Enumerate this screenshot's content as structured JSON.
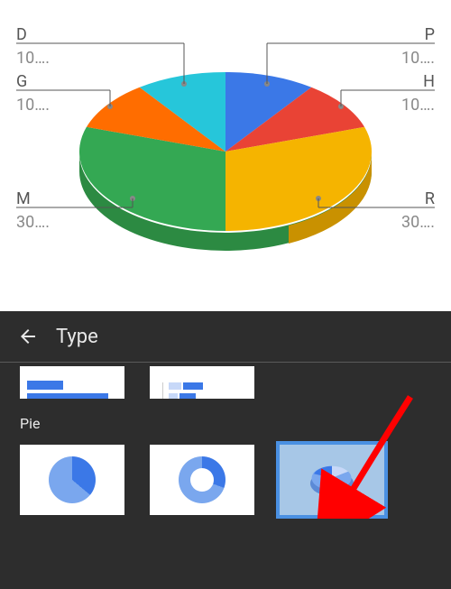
{
  "chart_data": {
    "type": "pie",
    "style": "3d",
    "slices": [
      {
        "label": "P",
        "value": 10,
        "color": "#3b78e7"
      },
      {
        "label": "H",
        "value": 10,
        "color": "#e94335"
      },
      {
        "label": "R",
        "value": 30,
        "color": "#f5b400"
      },
      {
        "label": "M",
        "value": 30,
        "color": "#34a853"
      },
      {
        "label": "G",
        "value": 10,
        "color": "#ff6d00"
      },
      {
        "label": "D",
        "value": 10,
        "color": "#26c6da"
      }
    ],
    "value_display_suffix": "…."
  },
  "labels": {
    "D": {
      "name": "D",
      "val": "10…."
    },
    "G": {
      "name": "G",
      "val": "10…."
    },
    "M": {
      "name": "M",
      "val": "30…."
    },
    "P": {
      "name": "P",
      "val": "10…."
    },
    "H": {
      "name": "H",
      "val": "10…."
    },
    "R": {
      "name": "R",
      "val": "30…."
    }
  },
  "panel": {
    "title": "Type",
    "section_pie": "Pie",
    "tiles": {
      "bar_prev_row": true,
      "pie_flat": "pie-flat",
      "pie_donut": "pie-donut",
      "pie_3d": "pie-3d",
      "selected": "pie-3d"
    }
  }
}
